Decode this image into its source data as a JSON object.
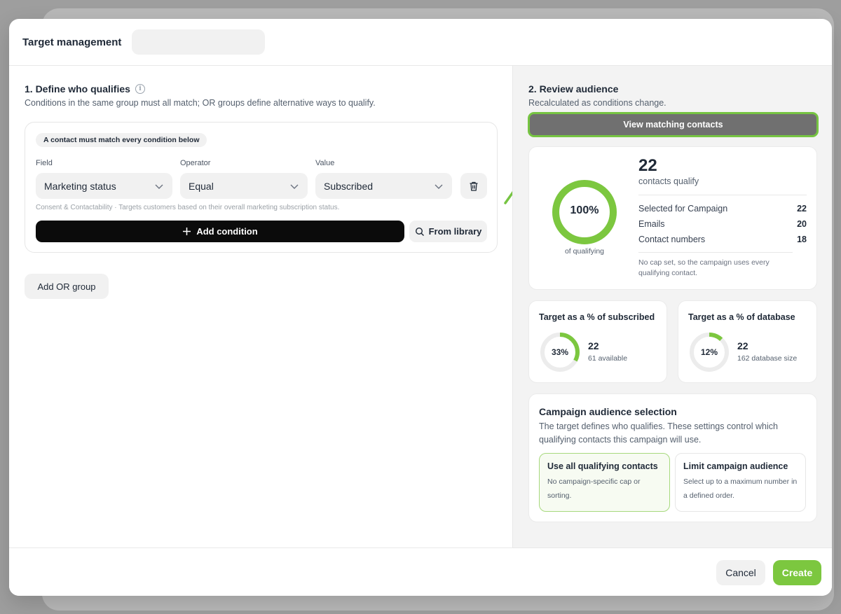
{
  "header": {
    "title": "Target management",
    "name_value": ""
  },
  "left": {
    "title": "1. Define who qualifies",
    "subtitle": "Conditions in the same group must all match; OR groups define alternative ways to qualify.",
    "group_chip": "A contact must match every condition below",
    "labels": {
      "field": "Field",
      "operator": "Operator",
      "value": "Value"
    },
    "condition": {
      "field": "Marketing status",
      "operator": "Equal",
      "value": "Subscribed"
    },
    "hint": "Consent & Contactability · Targets customers based on their overall marketing subscription status.",
    "add_condition": "Add condition",
    "from_library": "From library",
    "add_or_group": "Add OR group"
  },
  "right": {
    "title": "2. Review audience",
    "subtitle": "Recalculated as conditions change.",
    "view_button": "View matching contacts",
    "summary": {
      "count": "22",
      "count_label": "contacts qualify",
      "ring_value": "100%",
      "ring_percent": 100,
      "ring_caption": "of qualifying",
      "rows": [
        {
          "label": "Selected for Campaign",
          "value": "22"
        },
        {
          "label": "Emails",
          "value": "20"
        },
        {
          "label": "Contact numbers",
          "value": "18"
        }
      ],
      "note": "No cap set, so the campaign uses every qualifying contact."
    },
    "subscribed": {
      "title": "Target as a % of subscribed",
      "ring_value": "33%",
      "ring_percent": 33,
      "count": "22",
      "detail": "61 available"
    },
    "database": {
      "title": "Target as a % of database",
      "ring_value": "12%",
      "ring_percent": 12,
      "count": "22",
      "detail": "162 database size"
    },
    "selection": {
      "title": "Campaign audience selection",
      "desc": "The target defines who qualifies. These settings control which qualifying contacts this campaign will use.",
      "options": [
        {
          "title": "Use all qualifying contacts",
          "desc": "No campaign-specific cap or sorting."
        },
        {
          "title": "Limit campaign audience",
          "desc": "Select up to a maximum number in a defined order."
        }
      ]
    }
  },
  "footer": {
    "cancel": "Cancel",
    "create": "Create"
  },
  "colors": {
    "accent": "#7cc73f",
    "ring_track": "#ececec",
    "highlight": "#76c442"
  }
}
